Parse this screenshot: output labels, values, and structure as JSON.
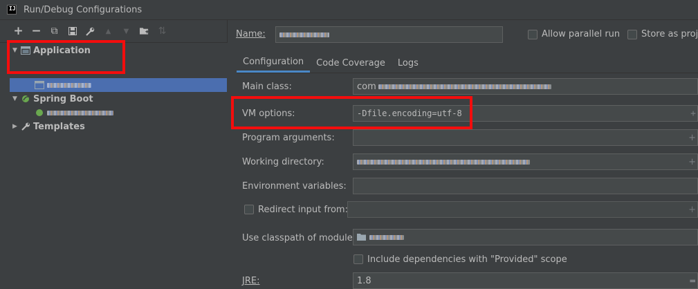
{
  "window": {
    "title": "Run/Debug Configurations",
    "logo_text": "IJ"
  },
  "toolbar": {
    "icons": [
      "add-icon",
      "remove-icon",
      "copy-icon",
      "save-icon",
      "wrench-icon",
      "move-up-icon",
      "move-down-icon",
      "folder-add-icon",
      "sort-icon"
    ],
    "glyphs": {
      "add": "+",
      "remove": "−",
      "copy": "⧉",
      "save": "▪",
      "wrench": "🔧",
      "up": "▲",
      "down": "▼",
      "folder": "▆",
      "sort": "⇅"
    }
  },
  "tree": {
    "application": {
      "label": "Application",
      "arrow": "▼"
    },
    "spring_boot": {
      "label": "Spring Boot",
      "arrow": "▼"
    },
    "templates": {
      "label": "Templates",
      "arrow": "▶"
    }
  },
  "form": {
    "name_label": "Name:",
    "allow_parallel": "Allow parallel run",
    "store_as_project": "Store as proje",
    "tabs": [
      "Configuration",
      "Code Coverage",
      "Logs"
    ],
    "main_class_label": "Main class:",
    "main_class_prefix": "com",
    "vm_options_label": "VM options:",
    "vm_options_value": "-Dfile.encoding=utf-8",
    "program_args_label": "Program arguments:",
    "working_dir_label": "Working directory:",
    "env_vars_label": "Environment variables:",
    "redirect_input_label": "Redirect input from:",
    "classpath_label": "Use classpath of module:",
    "include_deps_label": "Include dependencies with \"Provided\" scope",
    "jre_label": "JRE:",
    "jre_value": "1.8",
    "plus": "+"
  },
  "colors": {
    "highlight": "#f40d0d",
    "selection": "#4b6eaf",
    "tab_underline": "#4a88c7"
  }
}
